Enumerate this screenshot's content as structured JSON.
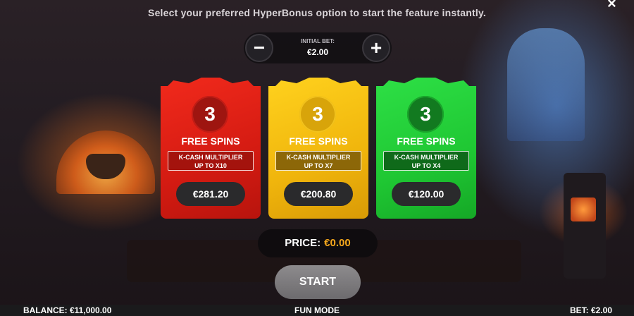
{
  "header": {
    "subtitle": "Select your preferred HyperBonus option to start the feature instantly.",
    "close_icon": "close-icon"
  },
  "bet_selector": {
    "label": "INITIAL BET:",
    "value": "€2.00",
    "decrease_label": "−",
    "increase_label": "+"
  },
  "options": [
    {
      "count": "3",
      "title": "FREE SPINS",
      "multiplier_line1": "K-CASH MULTIPLIER",
      "multiplier_line2": "UP TO X10",
      "price": "€281.20",
      "color": "#e4211a"
    },
    {
      "count": "3",
      "title": "FREE SPINS",
      "multiplier_line1": "K-CASH MULTIPLIER",
      "multiplier_line2": "UP TO X7",
      "price": "€200.80",
      "color": "#f4be10"
    },
    {
      "count": "3",
      "title": "FREE SPINS",
      "multiplier_line1": "K-CASH MULTIPLIER",
      "multiplier_line2": "UP TO X4",
      "price": "€120.00",
      "color": "#22cf38"
    }
  ],
  "price": {
    "label": "PRICE:",
    "value": "€0.00",
    "value_color": "#f6a81c"
  },
  "start_button": {
    "label": "START"
  },
  "footer": {
    "balance": "BALANCE: €11,000.00",
    "mode": "FUN MODE",
    "bet": "BET: €2.00"
  }
}
